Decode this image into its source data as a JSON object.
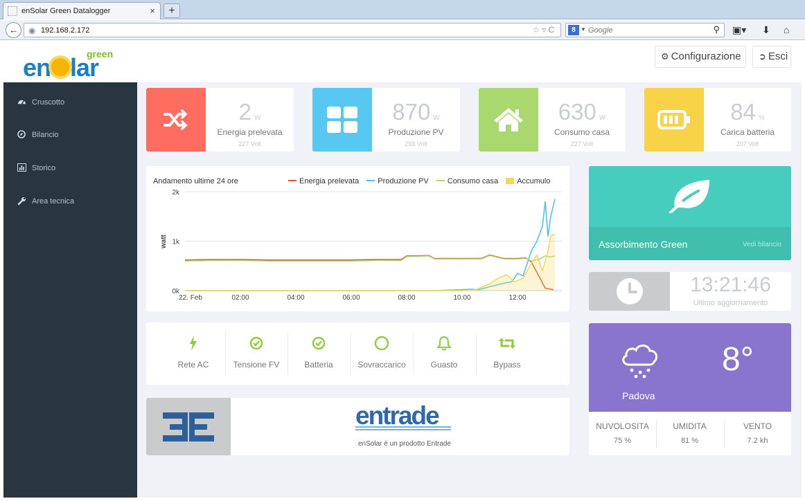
{
  "browser": {
    "tab_title": "enSolar Green Datalogger",
    "new_tab": "+",
    "tab_close": "×",
    "url": "192.168.2.172",
    "search_placeholder": "Google",
    "search_engine_badge": "8"
  },
  "header": {
    "logo_green": "green",
    "logo_en": "en",
    "logo_s": "S",
    "logo_lar": "lar",
    "config_label": "Configurazione",
    "exit_label": "Esci"
  },
  "sidebar": {
    "items": [
      {
        "label": "Cruscotto",
        "icon": "dashboard-icon"
      },
      {
        "label": "Bilancio",
        "icon": "compass-icon"
      },
      {
        "label": "Storico",
        "icon": "bar-chart-icon"
      },
      {
        "label": "Area tecnica",
        "icon": "wrench-icon"
      }
    ]
  },
  "stats": [
    {
      "value": "2",
      "unit": "W",
      "label": "Energia prelevata",
      "sub": "227 Volt",
      "color": "#ff6c60",
      "icon": "shuffle-icon"
    },
    {
      "value": "870",
      "unit": "W",
      "label": "Produzione PV",
      "sub": "293 Volt",
      "color": "#57c8f2",
      "icon": "grid-icon"
    },
    {
      "value": "630",
      "unit": "W",
      "label": "Consumo casa",
      "sub": "227 Volt",
      "color": "#a9d86e",
      "icon": "home-icon"
    },
    {
      "value": "84",
      "unit": "%",
      "label": "Carica batteria",
      "sub": "207 Volt",
      "color": "#f8d347",
      "icon": "battery-icon"
    }
  ],
  "chart_data": {
    "type": "line",
    "title": "Andamento ultime 24 ore",
    "ylabel": "watt",
    "xlabel": "",
    "x_ticks": [
      "22. Feb",
      "02:00",
      "04:00",
      "06:00",
      "08:00",
      "10:00",
      "12:00"
    ],
    "y_ticks": [
      "0k",
      "1k",
      "2k"
    ],
    "ylim": [
      0,
      2000
    ],
    "xlim": [
      0,
      13.6
    ],
    "legend_position": "top",
    "series": [
      {
        "name": "Energia prelevata",
        "color": "#e74c3c",
        "type": "line",
        "x": [
          0,
          1,
          2,
          3,
          4,
          5,
          6,
          7,
          7.8,
          8,
          8.8,
          9,
          10,
          10.5,
          10.7,
          11,
          11.5,
          12,
          12.3,
          12.5,
          13,
          13.3
        ],
        "y": [
          620,
          630,
          630,
          620,
          620,
          620,
          620,
          630,
          630,
          700,
          710,
          650,
          650,
          650,
          650,
          720,
          650,
          650,
          660,
          580,
          50,
          20
        ]
      },
      {
        "name": "Produzione PV",
        "color": "#49c1ea",
        "type": "line",
        "x": [
          0,
          1,
          2,
          3,
          4,
          5,
          6,
          7,
          8,
          9,
          9.5,
          10,
          10.3,
          10.6,
          11,
          11.5,
          11.8,
          12,
          12.2,
          12.5,
          12.7,
          12.9,
          13,
          13.1,
          13.2,
          13.35
        ],
        "y": [
          0,
          0,
          0,
          0,
          0,
          0,
          0,
          0,
          0,
          0,
          10,
          20,
          30,
          20,
          80,
          150,
          180,
          350,
          300,
          800,
          1000,
          1300,
          1800,
          1100,
          1500,
          1850
        ]
      },
      {
        "name": "Consumo casa",
        "color": "#a9d86e",
        "type": "line",
        "x": [
          0,
          1,
          2,
          3,
          4,
          5,
          6,
          7,
          7.8,
          8,
          8.8,
          9,
          10,
          10.5,
          10.7,
          11,
          11.5,
          12,
          12.3,
          12.5,
          12.8,
          13,
          13.2,
          13.35
        ],
        "y": [
          600,
          610,
          610,
          600,
          600,
          600,
          600,
          610,
          610,
          690,
          700,
          640,
          640,
          640,
          640,
          710,
          640,
          640,
          650,
          600,
          640,
          700,
          680,
          700
        ]
      },
      {
        "name": "Accumulo",
        "color": "#f0d85a",
        "type": "area",
        "x": [
          0,
          9,
          10,
          10.5,
          11,
          11.3,
          11.6,
          11.9,
          12.2,
          12.5,
          12.7,
          12.9,
          13.1,
          13.2,
          13.35
        ],
        "y": [
          0,
          0,
          0,
          20,
          140,
          250,
          320,
          180,
          250,
          550,
          720,
          400,
          800,
          1100,
          1150
        ]
      }
    ]
  },
  "green_card": {
    "title": "Assorbimento Green",
    "link": "Vedi bilancio",
    "bg": "#47cdbd"
  },
  "clock_card": {
    "time": "13:21:46",
    "caption": "Ultimo aggiornamento"
  },
  "status": [
    {
      "label": "Rete AC",
      "icon": "bolt-icon"
    },
    {
      "label": "Tensione FV",
      "icon": "check-circle-icon"
    },
    {
      "label": "Batteria",
      "icon": "check-circle-icon"
    },
    {
      "label": "Sovraccarico",
      "icon": "circle-icon"
    },
    {
      "label": "Guasto",
      "icon": "bell-icon"
    },
    {
      "label": "Bypass",
      "icon": "retweet-icon"
    }
  ],
  "entrade": {
    "logo_text": "entrade",
    "caption": "enSolar è un prodotto Entrade"
  },
  "weather": {
    "temp": "8°",
    "city": "Padova",
    "bg": "#8975cd",
    "cols": [
      {
        "label": "NUVOLOSITA",
        "value": "75 %"
      },
      {
        "label": "UMIDITA",
        "value": "81 %"
      },
      {
        "label": "VENTO",
        "value": "7.2 kh"
      }
    ]
  }
}
